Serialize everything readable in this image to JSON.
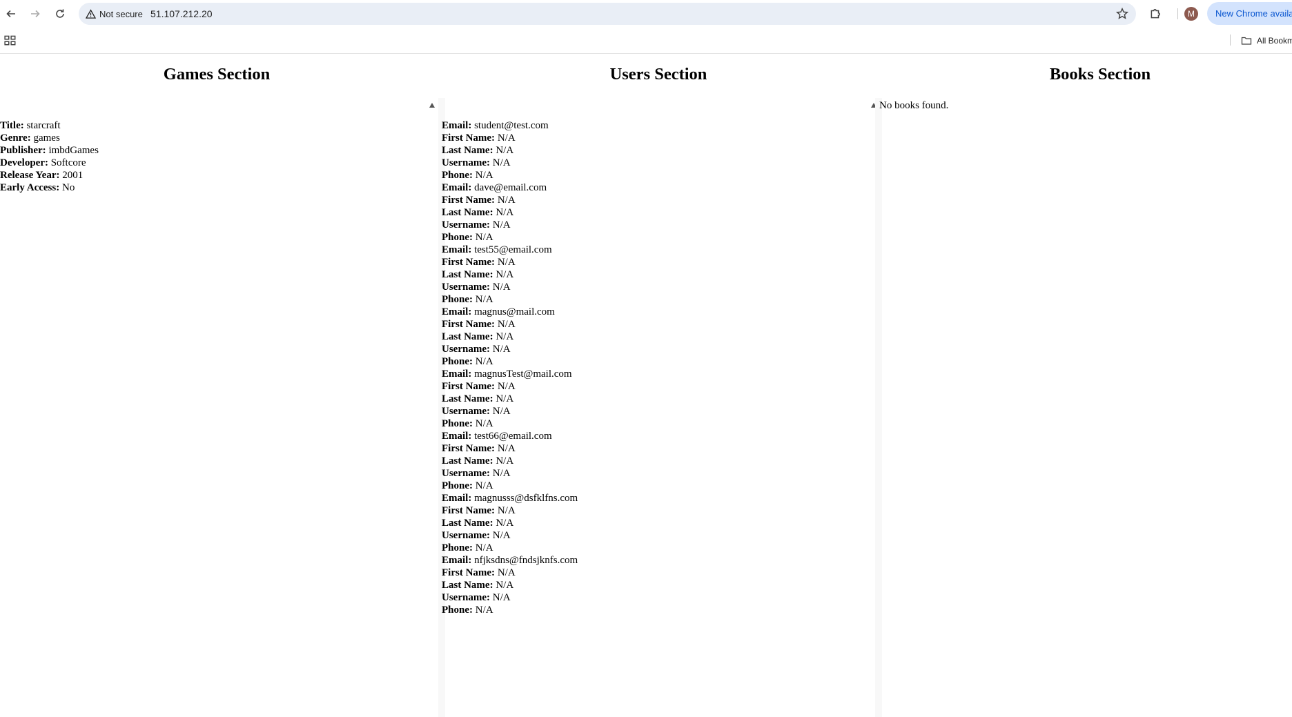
{
  "browser": {
    "security_label": "Not secure",
    "url": "51.107.212.20",
    "avatar_initial": "M",
    "chrome_update_label": "New Chrome available",
    "all_bookmarks_label": "All Bookmarks"
  },
  "games": {
    "heading": "Games Section",
    "fields": [
      {
        "label": "Title:",
        "value": "starcraft"
      },
      {
        "label": "Genre:",
        "value": "games"
      },
      {
        "label": "Publisher:",
        "value": "imbdGames"
      },
      {
        "label": "Developer:",
        "value": "Softcore"
      },
      {
        "label": "Release Year:",
        "value": "2001"
      },
      {
        "label": "Early Access:",
        "value": "No"
      }
    ]
  },
  "users": {
    "heading": "Users Section",
    "labels": {
      "email": "Email:",
      "first_name": "First Name:",
      "last_name": "Last Name:",
      "username": "Username:",
      "phone": "Phone:"
    },
    "items": [
      {
        "email": "student@test.com",
        "first_name": "N/A",
        "last_name": "N/A",
        "username": "N/A",
        "phone": "N/A"
      },
      {
        "email": "dave@email.com",
        "first_name": "N/A",
        "last_name": "N/A",
        "username": "N/A",
        "phone": "N/A"
      },
      {
        "email": "test55@email.com",
        "first_name": "N/A",
        "last_name": "N/A",
        "username": "N/A",
        "phone": "N/A"
      },
      {
        "email": "magnus@mail.com",
        "first_name": "N/A",
        "last_name": "N/A",
        "username": "N/A",
        "phone": "N/A"
      },
      {
        "email": "magnusTest@mail.com",
        "first_name": "N/A",
        "last_name": "N/A",
        "username": "N/A",
        "phone": "N/A"
      },
      {
        "email": "test66@email.com",
        "first_name": "N/A",
        "last_name": "N/A",
        "username": "N/A",
        "phone": "N/A"
      },
      {
        "email": "magnusss@dsfklfns.com",
        "first_name": "N/A",
        "last_name": "N/A",
        "username": "N/A",
        "phone": "N/A"
      },
      {
        "email": "nfjksdns@fndsjknfs.com",
        "first_name": "N/A",
        "last_name": "N/A",
        "username": "N/A",
        "phone": "N/A"
      }
    ]
  },
  "books": {
    "heading": "Books Section",
    "empty_message": "No books found."
  }
}
